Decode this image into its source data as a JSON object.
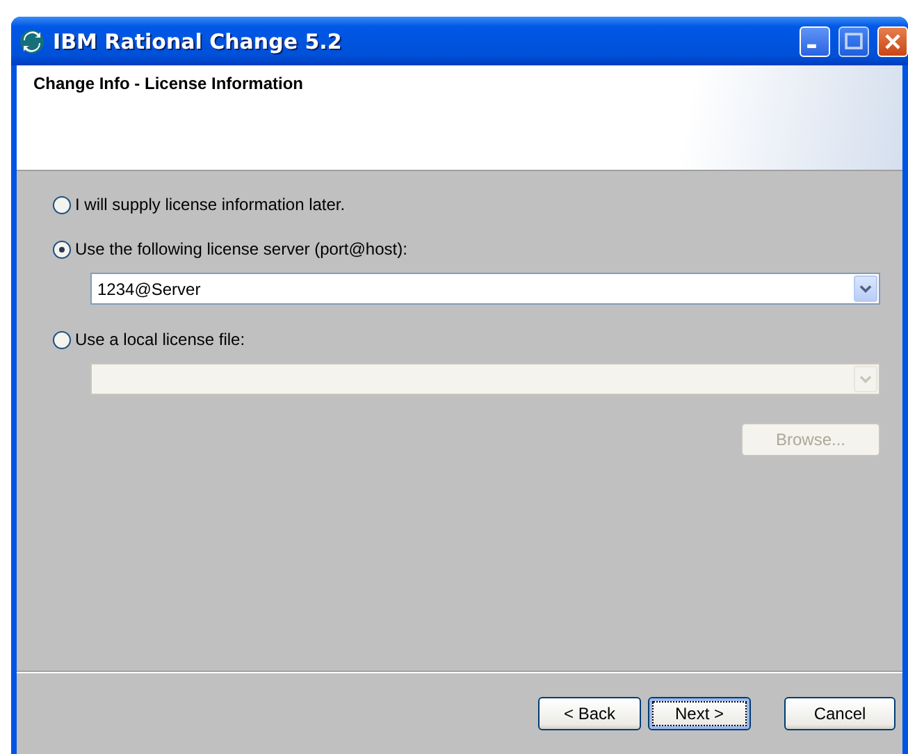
{
  "window": {
    "title": "IBM Rational Change 5.2"
  },
  "header": {
    "title": "Change Info - License Information"
  },
  "options": [
    {
      "label": "I will supply license information later.",
      "selected": false
    },
    {
      "label": "Use the following license server (port@host):",
      "selected": true,
      "combo": {
        "value": "1234@Server",
        "disabled": false
      }
    },
    {
      "label": "Use a local license file:",
      "selected": false,
      "combo": {
        "disabled": true
      },
      "browse": {
        "label": "Browse...",
        "disabled": true
      }
    }
  ],
  "buttons": [
    {
      "label": "< Back",
      "focused": false
    },
    {
      "label": "Next >",
      "focused": true
    },
    {
      "label": "Cancel",
      "focused": false
    }
  ]
}
